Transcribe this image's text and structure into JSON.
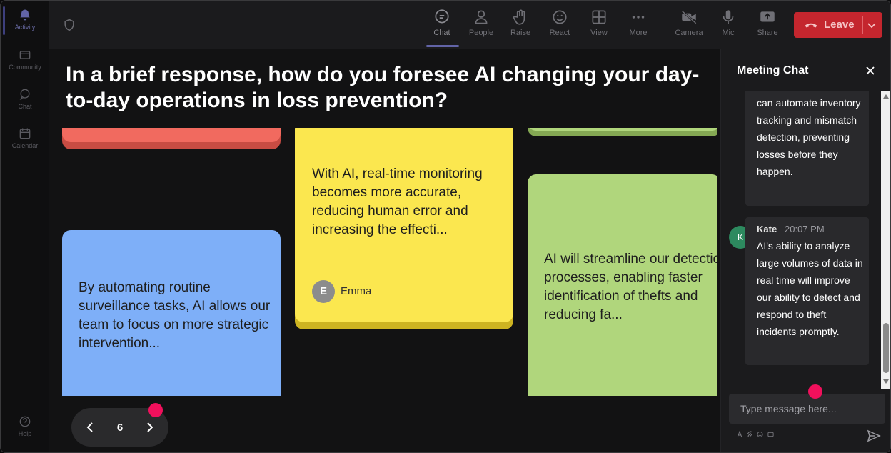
{
  "rail": {
    "items": [
      {
        "label": "Activity",
        "icon": "bell-icon"
      },
      {
        "label": "Community",
        "icon": "community-icon"
      },
      {
        "label": "Chat",
        "icon": "chat-icon"
      },
      {
        "label": "Calendar",
        "icon": "calendar-icon"
      },
      {
        "label": "Help",
        "icon": "help-icon"
      }
    ]
  },
  "toolbar": {
    "chat": "Chat",
    "people": "People",
    "raise": "Raise",
    "react": "React",
    "view": "View",
    "more": "More",
    "camera": "Camera",
    "mic": "Mic",
    "share": "Share",
    "leave": "Leave"
  },
  "question": "In a brief response, how do you foresee AI changing your day-to-day operations in loss prevention?",
  "notes": {
    "yellow": {
      "text": "With AI, real-time monitoring becomes more accurate, reducing human error and increasing the effecti...",
      "author_initial": "E",
      "author": "Emma"
    },
    "blue": {
      "text": "By automating routine surveillance tasks, AI allows our team to focus on more strategic intervention..."
    },
    "green": {
      "text": "AI will streamline our detection processes, enabling faster identification of thefts and reducing fa..."
    }
  },
  "pager": {
    "page": "6"
  },
  "chat": {
    "title": "Meeting Chat",
    "messages": [
      {
        "text": "can automate inventory tracking and mismatch detection, preventing losses before they happen."
      },
      {
        "author_initial": "K",
        "author": "Kate",
        "time": "20:07 PM",
        "text": "AI's ability to analyze large volumes of data in real time will improve our ability to detect and respond to theft incidents promptly."
      }
    ],
    "input_placeholder": "Type message here..."
  },
  "colors": {
    "note_red": "#f16a5f",
    "note_yellow": "#fbe74f",
    "note_blue": "#7eaff8",
    "note_green": "#b0d67c",
    "leave": "#c4262e",
    "accent": "#6264a7",
    "marker": "#f0105c"
  }
}
